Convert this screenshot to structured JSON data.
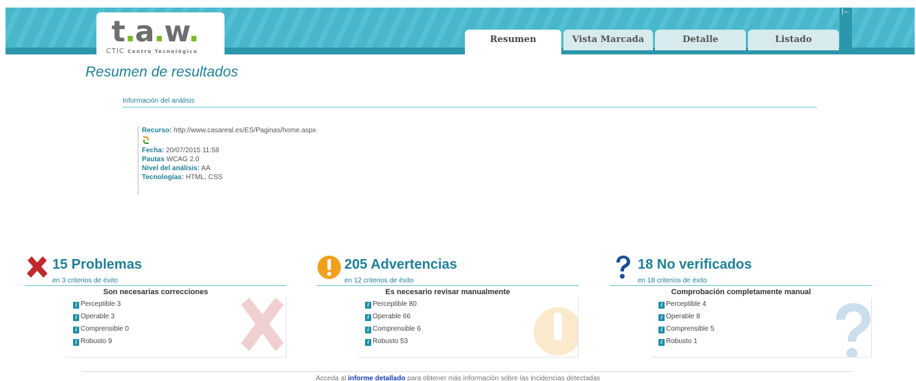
{
  "header": {
    "logo_main": "t.a.w.",
    "logo_sub_prefix": "CTIC",
    "logo_sub_rest": "Centro Tecnológico",
    "tabs": [
      {
        "label": "Resumen",
        "active": true
      },
      {
        "label": "Vista Marcada",
        "active": false
      },
      {
        "label": "Detalle",
        "active": false
      },
      {
        "label": "Listado",
        "active": false
      }
    ],
    "side_handle": "|←"
  },
  "page_title": "Resumen de resultados",
  "info": {
    "heading": "Información del análisis",
    "resource_label": "Recurso:",
    "resource_value": "http://www.casareal.es/ES/Paginas/home.aspx",
    "date_label": "Fecha:",
    "date_value": "20/07/2015 11:58",
    "guidelines_label": "Pautas",
    "guidelines_value": "WCAG 2.0",
    "level_label": "Nivel del análisis:",
    "level_value": "AA",
    "tech_label": "Tecnologías:",
    "tech_value": "HTML, CSS"
  },
  "summary": {
    "problems": {
      "title": "15 Problemas",
      "subtitle": "en 3 criterios de éxito",
      "heading": "Son necesarias correcciones",
      "items": [
        "Perceptible 3",
        "Operable 3",
        "Comprensible 0",
        "Robusto 9"
      ]
    },
    "warnings": {
      "title": "205 Advertencias",
      "subtitle": "en 12 criterios de éxito",
      "heading": "Es necesario revisar manualmente",
      "items": [
        "Perceptible 80",
        "Operable 66",
        "Comprensible 6",
        "Robusto 53"
      ]
    },
    "unverified": {
      "title": "18 No verificados",
      "subtitle": "en 18 criterios de éxito",
      "heading": "Comprobación completamente manual",
      "items": [
        "Perceptible 4",
        "Operable 8",
        "Comprensible 5",
        "Robusto 1"
      ]
    }
  },
  "footer": {
    "prefix": "Acceda al",
    "link": "informe detallado",
    "suffix": "para obtener más información sobre las incidencias detectadas"
  },
  "colors": {
    "accent": "#1f7f98",
    "banner": "#48b7cb",
    "error": "#c0282d",
    "warning": "#f0a01e",
    "unverified": "#1d4f93"
  }
}
